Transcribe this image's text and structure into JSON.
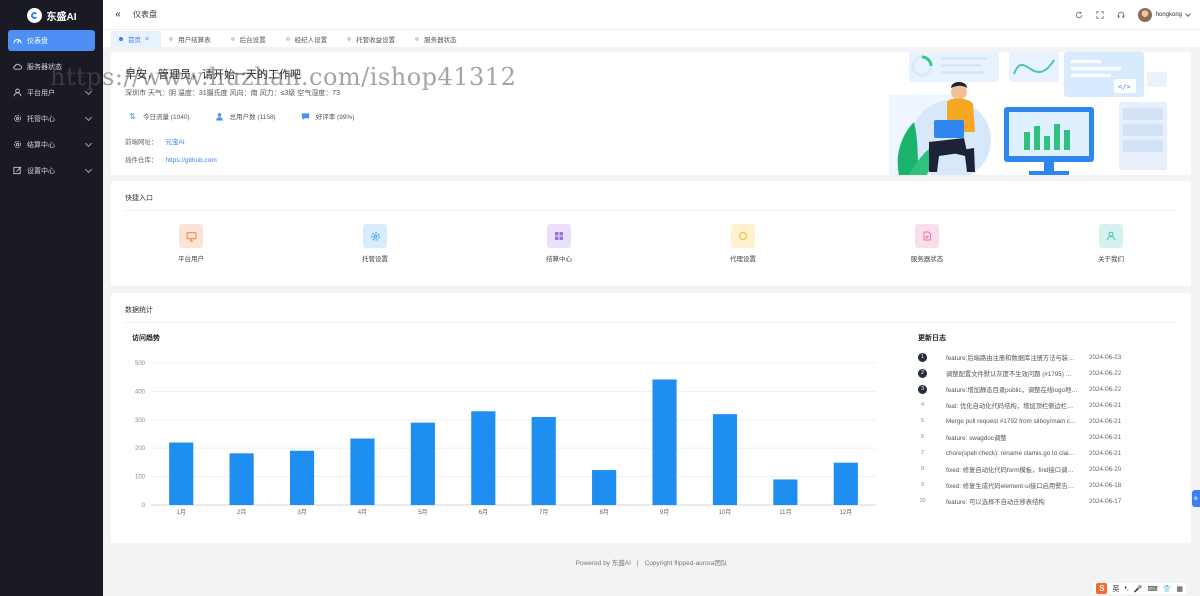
{
  "app": {
    "brand": "东盛AI",
    "colors": {
      "sidebar": "#191a23",
      "accent": "#4e8ff5",
      "bar": "#1e8ef0"
    }
  },
  "sidebar": {
    "items": [
      {
        "label": "仪表盘",
        "icon": "dashboard-icon",
        "active": true
      },
      {
        "label": "服务器状态",
        "icon": "cloud-icon"
      },
      {
        "label": "平台用户",
        "icon": "user-icon",
        "expandable": true
      },
      {
        "label": "托管中心",
        "icon": "settings-icon",
        "expandable": true
      },
      {
        "label": "结算中心",
        "icon": "gear-icon",
        "expandable": true
      },
      {
        "label": "设置中心",
        "icon": "edit-icon",
        "expandable": true
      }
    ]
  },
  "header": {
    "breadcrumb": "仪表盘",
    "username": "hongkong"
  },
  "tabs": [
    {
      "label": "首页",
      "active": true
    },
    {
      "label": "用户结算表"
    },
    {
      "label": "后台设置"
    },
    {
      "label": "经纪人设置"
    },
    {
      "label": "托管收益设置"
    },
    {
      "label": "服务器状态"
    }
  ],
  "welcome": {
    "greeting": "早安，管理员，请开始一天的工作吧",
    "weather": "深圳市 天气：阴 温度：31摄氏度 风向：南 风力：≤3级 空气湿度：73",
    "stats": [
      {
        "label": "今日流量 (1040)",
        "icon": "traffic-icon"
      },
      {
        "label": "总用户数 (1158)",
        "icon": "users-icon"
      },
      {
        "label": "好评率 (99%)",
        "icon": "comment-icon"
      }
    ],
    "frontend_label": "前端网址：",
    "frontend_link": "元宝AI",
    "plugin_label": "插件仓库：",
    "plugin_link": "https://github.com"
  },
  "watermark": "https://www.huzhan.com/ishop41312",
  "quick": {
    "title": "快捷入口",
    "items": [
      {
        "label": "平台用户",
        "icon": "monitor-icon",
        "bg": "#fde2d6",
        "fg": "#f0875a"
      },
      {
        "label": "托管设置",
        "icon": "settings-icon",
        "bg": "#d8ecfb",
        "fg": "#49a3ea"
      },
      {
        "label": "结算中心",
        "icon": "grid-icon",
        "bg": "#eadff8",
        "fg": "#9b6fe0"
      },
      {
        "label": "代理设置",
        "icon": "circle-icon",
        "bg": "#fdf1cf",
        "fg": "#f0bb3a"
      },
      {
        "label": "服务器状态",
        "icon": "document-icon",
        "bg": "#fbdeec",
        "fg": "#e872ad"
      },
      {
        "label": "关于我们",
        "icon": "person-icon",
        "bg": "#d6f2ef",
        "fg": "#3fbfae"
      }
    ]
  },
  "data_stats": {
    "title": "数据统计",
    "chart_title": "访问趋势",
    "log_title": "更新日志"
  },
  "chart_data": {
    "type": "bar",
    "title": "访问趋势",
    "categories": [
      "1月",
      "2月",
      "3月",
      "4月",
      "5月",
      "6月",
      "7月",
      "8月",
      "9月",
      "10月",
      "11月",
      "12月"
    ],
    "values": [
      220,
      182,
      191,
      234,
      290,
      330,
      310,
      123,
      442,
      320,
      90,
      149
    ],
    "yticks": [
      "0",
      "100",
      "200",
      "300",
      "400",
      "500"
    ],
    "ylim": [
      0,
      500
    ],
    "grid": true
  },
  "changelog": [
    {
      "message": "feature:后端路由注册和数据库注册方法与装…",
      "date": "2024-06-23"
    },
    {
      "message": "调整配置文件默认灰度不生效问题 (#1795) …",
      "date": "2024-06-22"
    },
    {
      "message": "feature:增加静态目录public，调整在线logo地…",
      "date": "2024-06-22"
    },
    {
      "message": "feat: 优化自动化代码结构，增加顶栏侧边栏…",
      "date": "2024-06-21"
    },
    {
      "message": "Merge pull request #1792 from sliboy/main c…",
      "date": "2024-06-21"
    },
    {
      "message": "feature: swagdoc调整",
      "date": "2024-06-21"
    },
    {
      "message": "chore(spell check): rename clamis.go to clai…",
      "date": "2024-06-21"
    },
    {
      "message": "fixed: 修复自动化代码form模板，find接口调…",
      "date": "2024-06-20"
    },
    {
      "message": "fixed: 修复生成代码element-ui接口启用警告…",
      "date": "2024-06-18"
    },
    {
      "message": "feature: 可以选择不自动迁移表结构",
      "date": "2024-06-17"
    }
  ],
  "footer": {
    "powered": "Powered by 东盛AI",
    "copyright": "Copyright flipped-aurora团队"
  },
  "ime": {
    "brand": "S",
    "lang": "英"
  }
}
